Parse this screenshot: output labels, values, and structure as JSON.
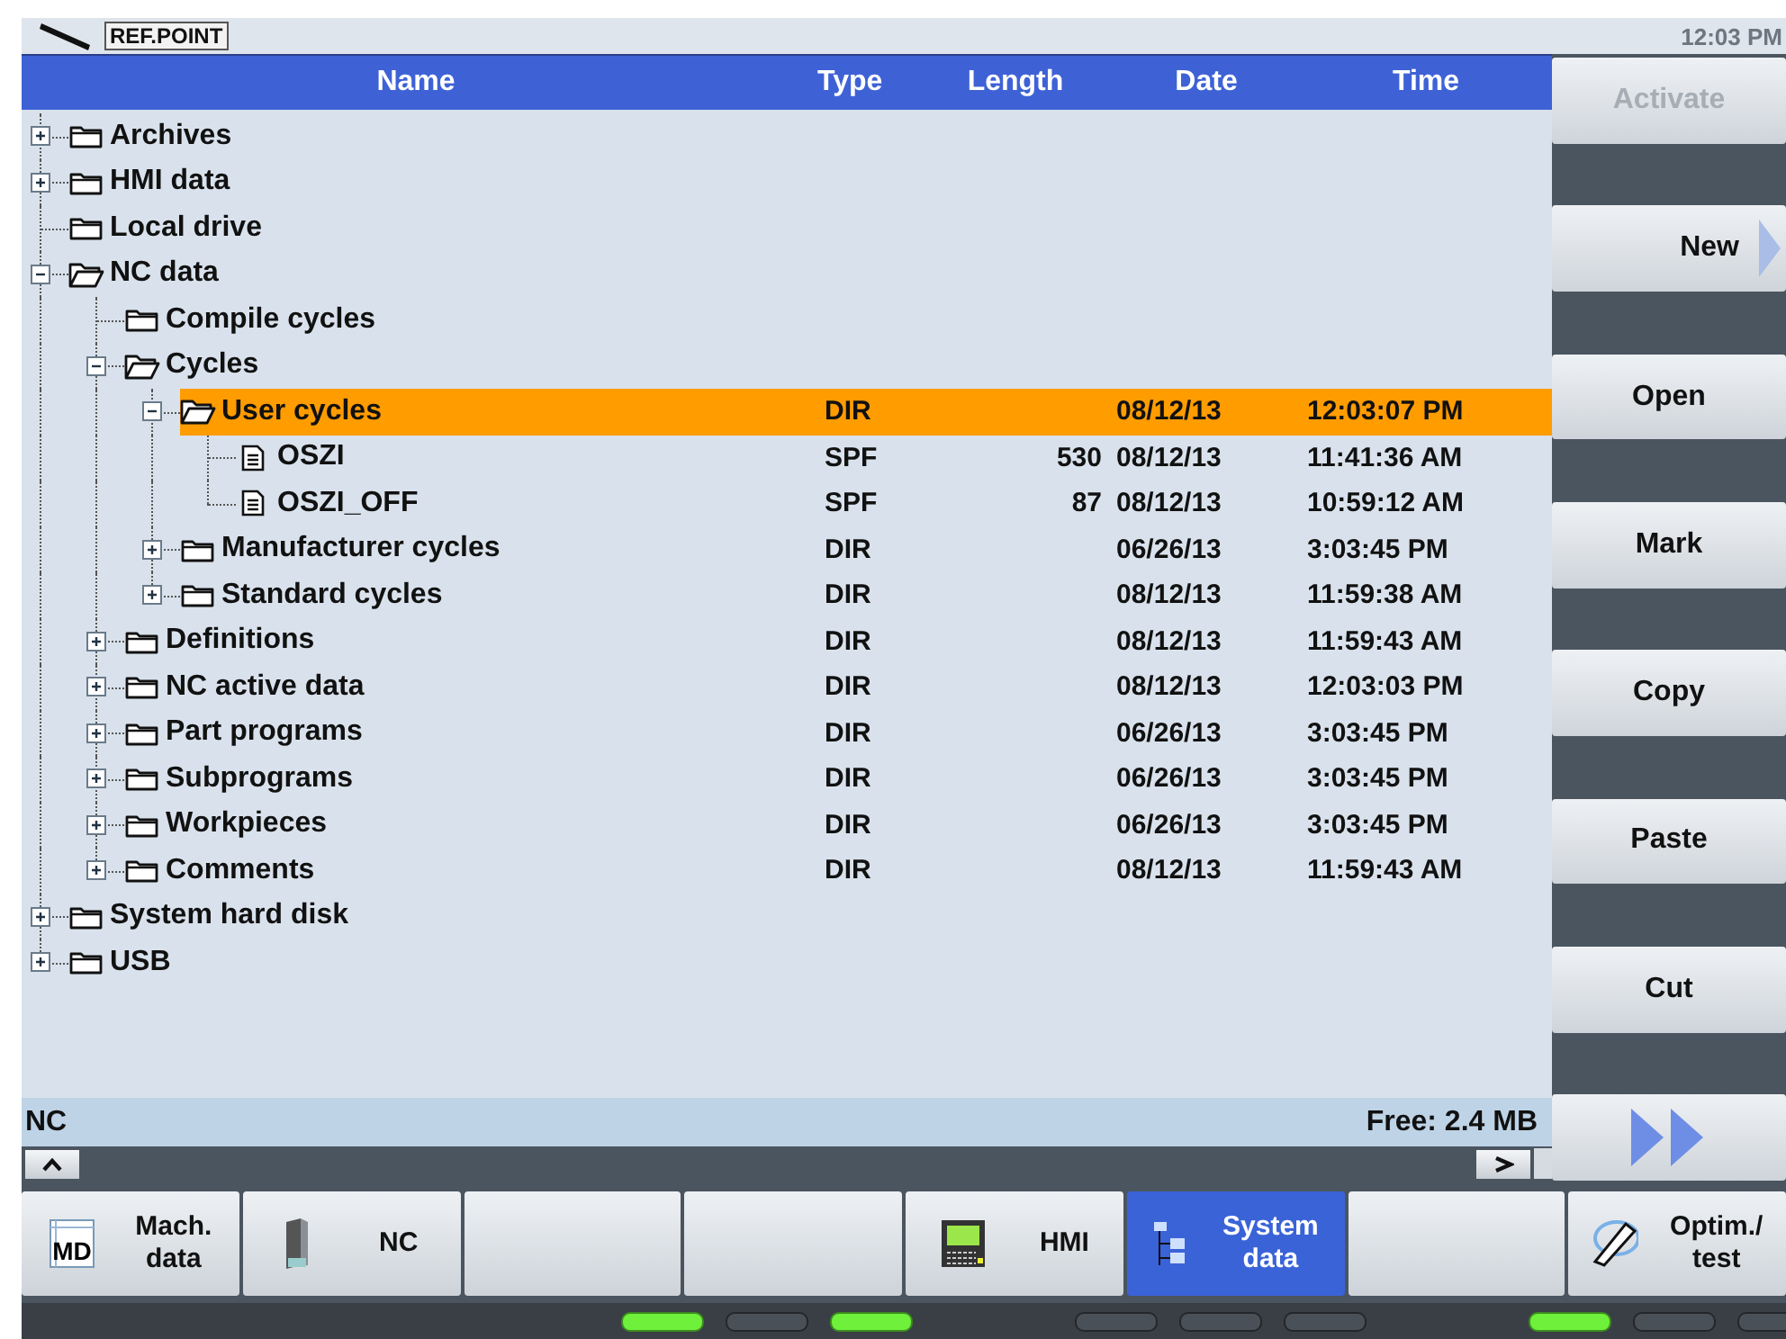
{
  "header": {
    "mode_label": "REF.POINT",
    "time": "12:03 PM"
  },
  "columns": [
    "Name",
    "Type",
    "Length",
    "Date",
    "Time"
  ],
  "tree": [
    {
      "name": "Archives",
      "kind": "folder",
      "expandable": true,
      "expanded": false,
      "selected": false
    },
    {
      "name": "HMI data",
      "kind": "folder",
      "expandable": true,
      "expanded": false,
      "selected": false
    },
    {
      "name": "Local drive",
      "kind": "folder",
      "expandable": false,
      "expanded": false,
      "selected": false
    },
    {
      "name": "NC data",
      "kind": "folder",
      "expandable": true,
      "expanded": true,
      "selected": false,
      "children": [
        {
          "name": "Compile cycles",
          "kind": "folder",
          "expandable": false,
          "expanded": false,
          "selected": false
        },
        {
          "name": "Cycles",
          "kind": "folder",
          "expandable": true,
          "expanded": true,
          "selected": false,
          "children": [
            {
              "name": "User cycles",
              "kind": "folder",
              "expandable": true,
              "expanded": true,
              "selected": true,
              "type": "DIR",
              "date": "08/12/13",
              "time": "12:03:07 PM",
              "children": [
                {
                  "name": "OSZI",
                  "kind": "file",
                  "selected": false,
                  "type": "SPF",
                  "length": "530",
                  "date": "08/12/13",
                  "time": "11:41:36 AM"
                },
                {
                  "name": "OSZI_OFF",
                  "kind": "file",
                  "selected": false,
                  "type": "SPF",
                  "length": "87",
                  "date": "08/12/13",
                  "time": "10:59:12 AM"
                }
              ]
            },
            {
              "name": "Manufacturer cycles",
              "kind": "folder",
              "expandable": true,
              "expanded": false,
              "selected": false,
              "type": "DIR",
              "date": "06/26/13",
              "time": "3:03:45 PM"
            },
            {
              "name": "Standard cycles",
              "kind": "folder",
              "expandable": true,
              "expanded": false,
              "selected": false,
              "type": "DIR",
              "date": "08/12/13",
              "time": "11:59:38 AM"
            }
          ]
        },
        {
          "name": "Definitions",
          "kind": "folder",
          "expandable": true,
          "expanded": false,
          "selected": false,
          "type": "DIR",
          "date": "08/12/13",
          "time": "11:59:43 AM"
        },
        {
          "name": "NC active data",
          "kind": "folder",
          "expandable": true,
          "expanded": false,
          "selected": false,
          "type": "DIR",
          "date": "08/12/13",
          "time": "12:03:03 PM"
        },
        {
          "name": "Part programs",
          "kind": "folder",
          "expandable": true,
          "expanded": false,
          "selected": false,
          "type": "DIR",
          "date": "06/26/13",
          "time": "3:03:45 PM"
        },
        {
          "name": "Subprograms",
          "kind": "folder",
          "expandable": true,
          "expanded": false,
          "selected": false,
          "type": "DIR",
          "date": "06/26/13",
          "time": "3:03:45 PM"
        },
        {
          "name": "Workpieces",
          "kind": "folder",
          "expandable": true,
          "expanded": false,
          "selected": false,
          "type": "DIR",
          "date": "06/26/13",
          "time": "3:03:45 PM"
        },
        {
          "name": "Comments",
          "kind": "folder",
          "expandable": true,
          "expanded": false,
          "selected": false,
          "type": "DIR",
          "date": "08/12/13",
          "time": "11:59:43 AM"
        }
      ]
    },
    {
      "name": "System hard disk",
      "kind": "folder",
      "expandable": true,
      "expanded": false,
      "selected": false
    },
    {
      "name": "USB",
      "kind": "folder",
      "expandable": true,
      "expanded": false,
      "selected": false
    }
  ],
  "status_bar": {
    "path": "NC",
    "free": "Free: 2.4 MB"
  },
  "side_buttons": [
    {
      "label": "Activate",
      "kind": "text",
      "disabled": true
    },
    {
      "label": "New",
      "kind": "submenu",
      "disabled": false
    },
    {
      "label": "Open",
      "kind": "text",
      "disabled": false
    },
    {
      "label": "Mark",
      "kind": "text",
      "disabled": false
    },
    {
      "label": "Copy",
      "kind": "text",
      "disabled": false
    },
    {
      "label": "Paste",
      "kind": "text",
      "disabled": false
    },
    {
      "label": "Cut",
      "kind": "text",
      "disabled": false
    },
    {
      "kind": "more"
    }
  ],
  "softkeys": [
    {
      "label": "Mach.\ndata",
      "kind": "md",
      "icon_text": "MD",
      "selected": false
    },
    {
      "label": "NC",
      "kind": "nc",
      "selected": false
    },
    {
      "kind": "empty",
      "selected": false
    },
    {
      "kind": "empty",
      "selected": false
    },
    {
      "label": "HMI",
      "kind": "hmi",
      "selected": false
    },
    {
      "label": "System\ndata",
      "kind": "sysdata",
      "selected": true
    },
    {
      "kind": "empty",
      "selected": false
    },
    {
      "label": "Optim./\ntest",
      "kind": "optim",
      "selected": false
    }
  ],
  "leds": [
    {
      "on": true
    },
    {
      "on": false
    },
    {
      "on": true
    },
    {
      "on": false
    },
    {
      "on": false
    },
    {
      "on": false
    },
    {
      "on": true
    },
    {
      "on": false
    },
    {
      "on": false
    }
  ]
}
